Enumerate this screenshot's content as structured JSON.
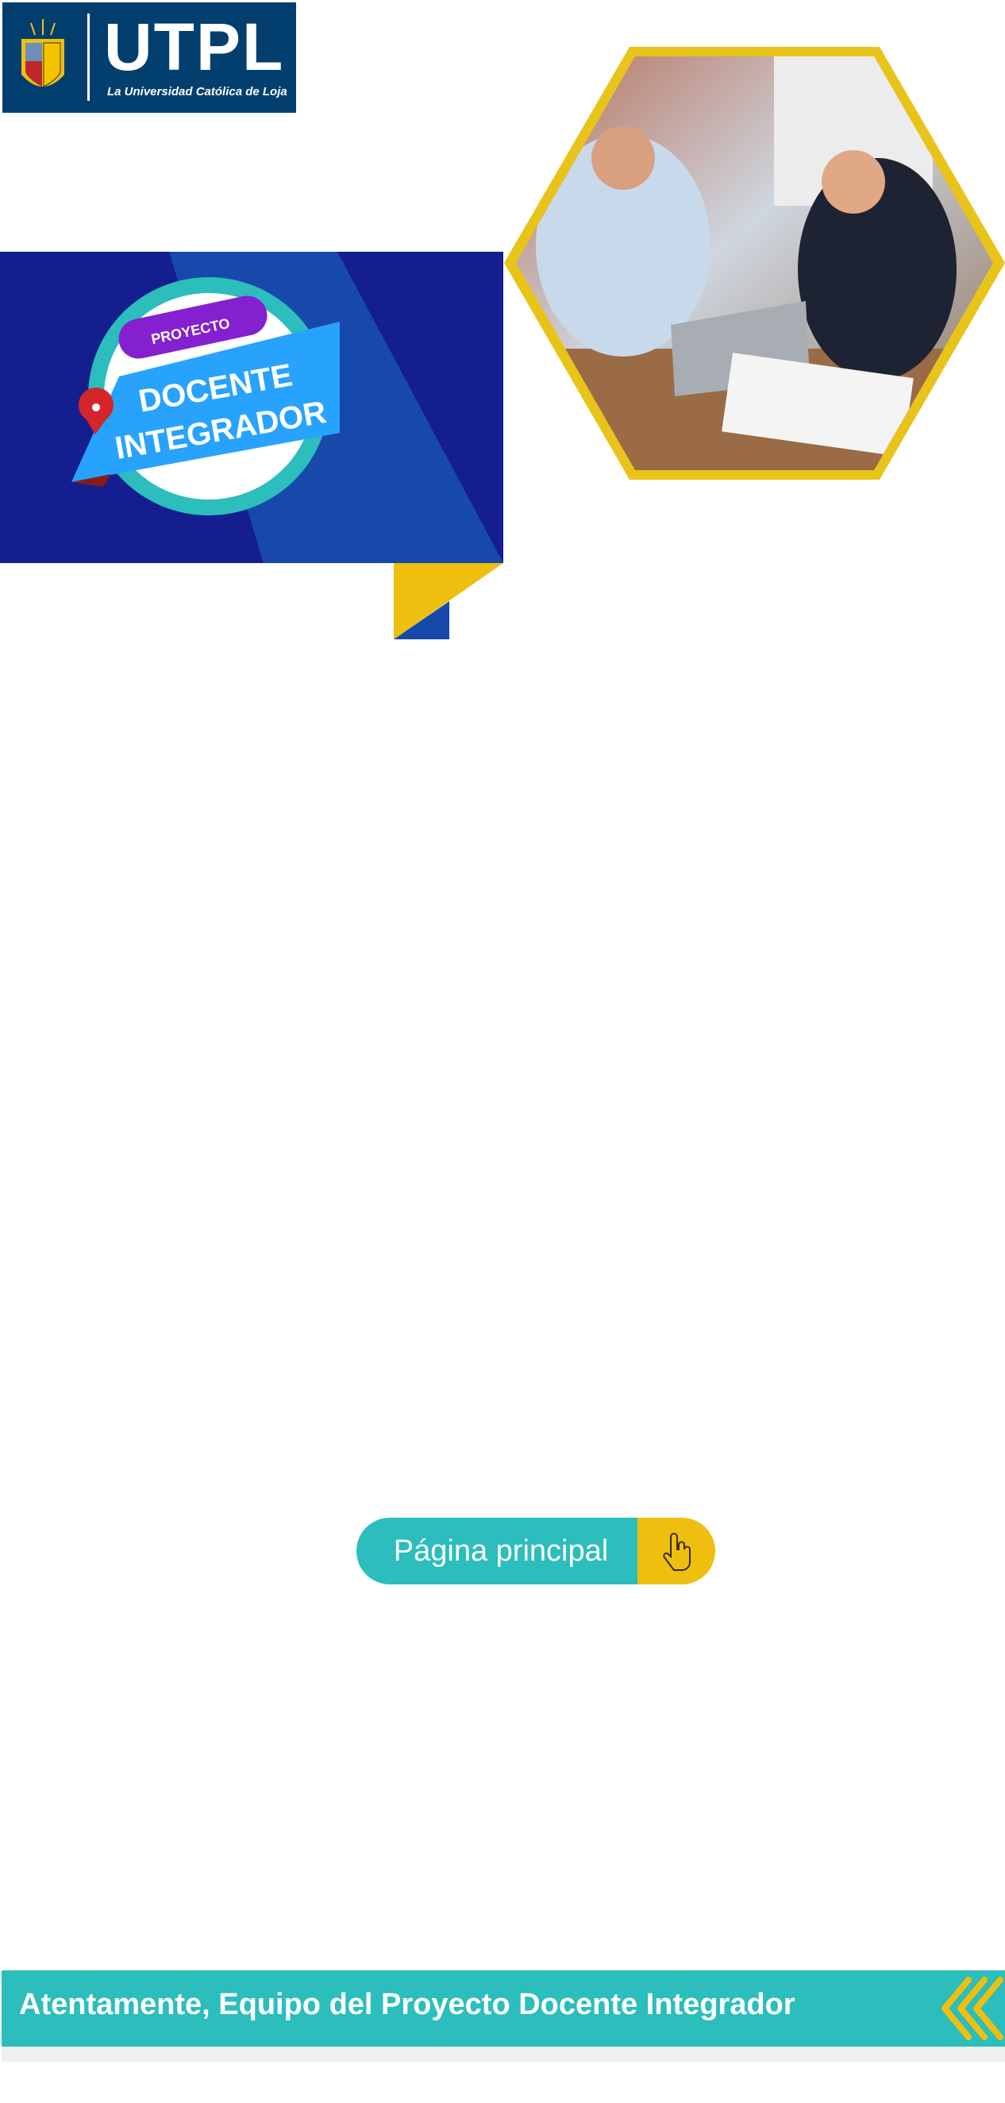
{
  "logo": {
    "title": "UTPL",
    "subtitle": "La Universidad Católica de Loja"
  },
  "banner": {
    "tag": "PROYECTO",
    "line1": "DOCENTE",
    "line2": "INTEGRADOR"
  },
  "button": {
    "label": "Página principal",
    "icon": "hand-pointer-icon"
  },
  "footer": {
    "text": "Atentamente, Equipo del Proyecto Docente Integrador",
    "icon": "chevrons-left-icon"
  },
  "colors": {
    "navy": "#023f6f",
    "teal": "#2cbdbd",
    "yellow": "#eebf0e",
    "blue_dark": "#141e8f",
    "blue": "#1749ab"
  }
}
